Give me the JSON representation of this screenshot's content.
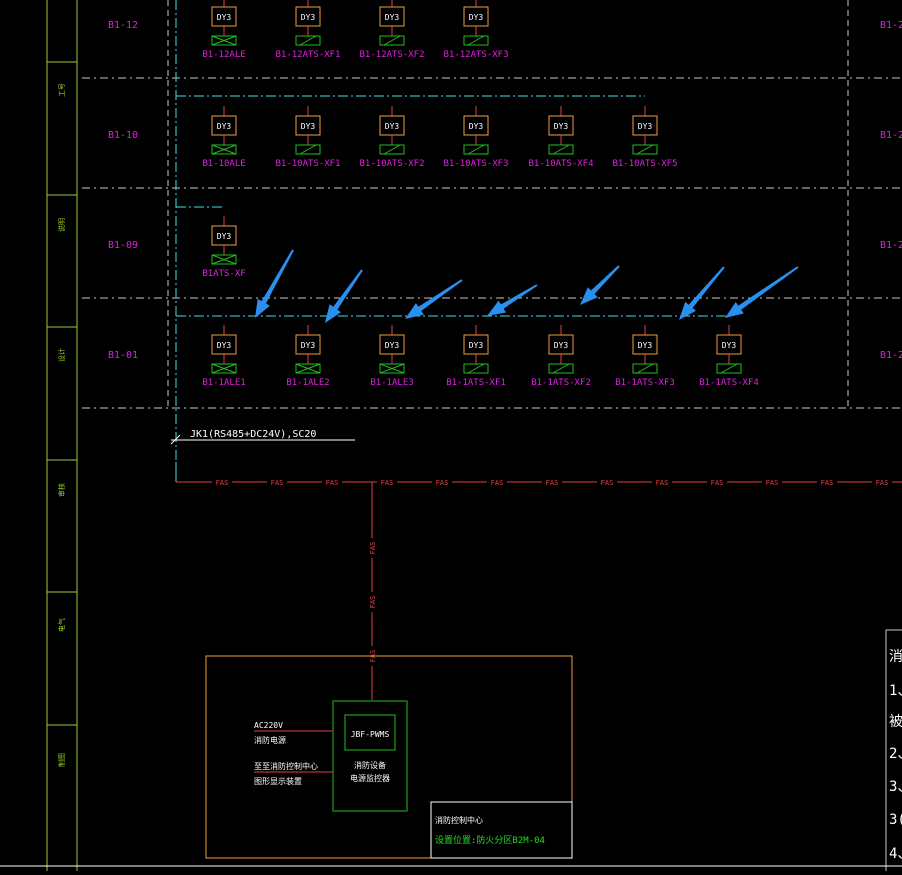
{
  "colors": {
    "background": "#000000",
    "floor_label": "#e020e0",
    "device_label": "#e020e0",
    "module_box": "#f0a040",
    "module_text": "#ffffff",
    "device_box": "#20c020",
    "bus_line": "#40e0e0",
    "fas_line": "#e04040",
    "grid_dash": "#c8c8c8",
    "annotation_arrow": "#2a90f0",
    "title_strip": "#9acd32",
    "panel_frame": "#f0a040",
    "cabinet_frame": "#20c020"
  },
  "title_strip": {
    "labels": [
      "工号",
      "说明",
      "设计",
      "审核",
      "电气",
      "制图"
    ]
  },
  "floors": [
    {
      "label": "B1-12",
      "cut_label": "B1-2",
      "devices": [
        {
          "module": "DY3",
          "name": "B1-12ALE",
          "symbol": "cross"
        },
        {
          "module": "DY3",
          "name": "B1-12ATS-XF1",
          "symbol": "slash"
        },
        {
          "module": "DY3",
          "name": "B1-12ATS-XF2",
          "symbol": "slash"
        },
        {
          "module": "DY3",
          "name": "B1-12ATS-XF3",
          "symbol": "slash"
        }
      ]
    },
    {
      "label": "B1-10",
      "cut_label": "B1-2",
      "devices": [
        {
          "module": "DY3",
          "name": "B1-10ALE",
          "symbol": "cross"
        },
        {
          "module": "DY3",
          "name": "B1-10ATS-XF1",
          "symbol": "slash"
        },
        {
          "module": "DY3",
          "name": "B1-10ATS-XF2",
          "symbol": "slash"
        },
        {
          "module": "DY3",
          "name": "B1-10ATS-XF3",
          "symbol": "slash"
        },
        {
          "module": "DY3",
          "name": "B1-10ATS-XF4",
          "symbol": "slash"
        },
        {
          "module": "DY3",
          "name": "B1-10ATS-XF5",
          "symbol": "slash"
        }
      ]
    },
    {
      "label": "B1-09",
      "cut_label": "B1-2",
      "devices": [
        {
          "module": "DY3",
          "name": "B1ATS-XF",
          "symbol": "cross"
        }
      ]
    },
    {
      "label": "B1-01",
      "cut_label": "B1-2",
      "devices": [
        {
          "module": "DY3",
          "name": "B1-1ALE1",
          "symbol": "cross"
        },
        {
          "module": "DY3",
          "name": "B1-1ALE2",
          "symbol": "cross"
        },
        {
          "module": "DY3",
          "name": "B1-1ALE3",
          "symbol": "cross"
        },
        {
          "module": "DY3",
          "name": "B1-1ATS-XF1",
          "symbol": "slash"
        },
        {
          "module": "DY3",
          "name": "B1-1ATS-XF2",
          "symbol": "slash"
        },
        {
          "module": "DY3",
          "name": "B1-1ATS-XF3",
          "symbol": "slash"
        },
        {
          "module": "DY3",
          "name": "B1-1ATS-XF4",
          "symbol": "slash"
        }
      ]
    }
  ],
  "cable_label": "JK1(RS485+DC24V),SC20",
  "fas_label": "FAS",
  "control_panel": {
    "power_line1": "AC220V",
    "power_line2": "消防电源",
    "link_line1": "至至消防控制中心",
    "link_line2": "图形显示装置",
    "host_model": "JBF-PWMS",
    "host_line1": "消防设备",
    "host_line2": "电源监控器",
    "room_line1": "消防控制中心",
    "room_line2": "设置位置:防火分区B2M-04"
  },
  "right_notes": [
    "消",
    "1、",
    "被",
    "2、",
    "3、",
    "3(",
    "4、"
  ]
}
